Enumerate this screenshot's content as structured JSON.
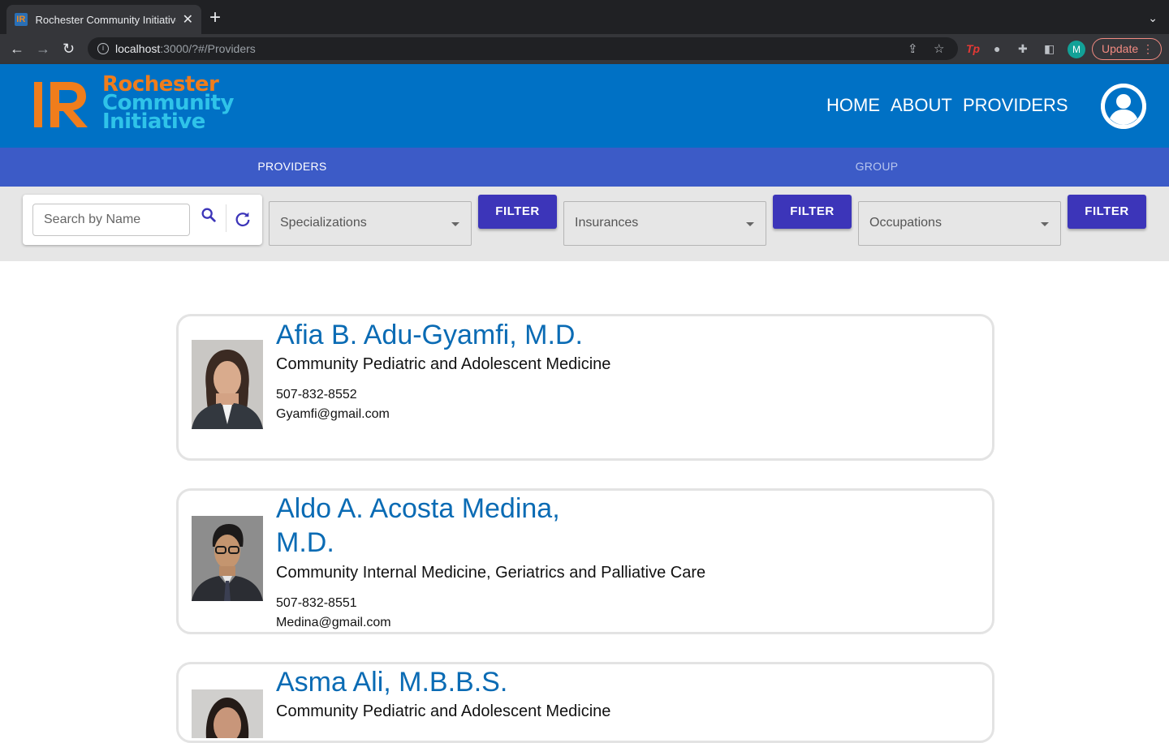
{
  "browser": {
    "tab_title": "Rochester Community Initiative",
    "favicon_text": "IR",
    "url_host": "localhost",
    "url_rest": ":3000/?#/Providers",
    "profile_initial": "M",
    "update_label": "Update",
    "new_tab_glyph": "+",
    "close_glyph": "✕"
  },
  "header": {
    "logo_lines": [
      "Rochester",
      "Community",
      "Initiative"
    ],
    "nav": [
      "HOME",
      "ABOUT",
      "PROVIDERS"
    ]
  },
  "subtabs": {
    "providers": "PROVIDERS",
    "group": "GROUP"
  },
  "filters": {
    "search_placeholder": "Search by Name",
    "specializations": "Specializations",
    "insurances": "Insurances",
    "occupations": "Occupations",
    "filter_label": "FILTER"
  },
  "providers": [
    {
      "name": "Afia B. Adu-Gyamfi, M.D.",
      "specialty": "Community Pediatric and Adolescent Medicine",
      "phone": "507-832-8552",
      "email": "Gyamfi@gmail.com"
    },
    {
      "name": "Aldo A. Acosta Medina, M.D.",
      "specialty": "Community Internal Medicine, Geriatrics and Palliative Care",
      "phone": "507-832-8551",
      "email": "Medina@gmail.com"
    },
    {
      "name": "Asma Ali, M.B.B.S.",
      "specialty": "Community Pediatric and Adolescent Medicine"
    }
  ],
  "colors": {
    "header_blue": "#0071c5",
    "subtab_blue": "#3c5bc7",
    "filter_button": "#3c35b9",
    "name_blue": "#0a6bb4",
    "logo_orange": "#f07d1c",
    "logo_cyan": "#2fc3e9"
  }
}
